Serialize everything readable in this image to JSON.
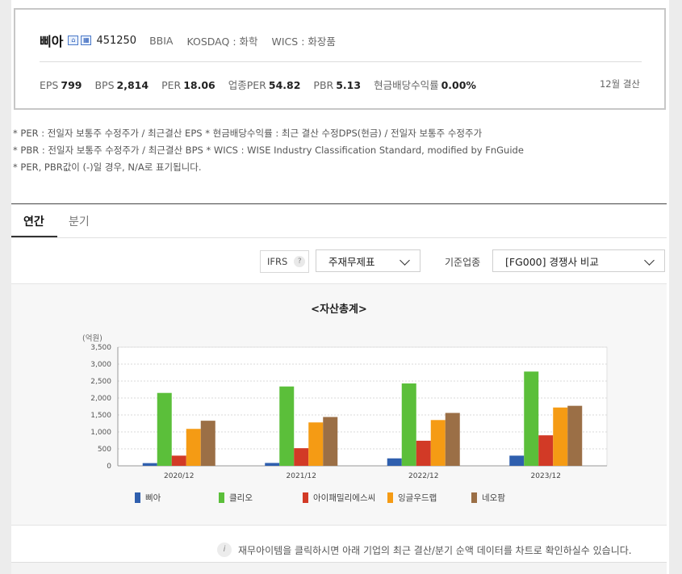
{
  "company": {
    "name": "삐아",
    "code": "451250",
    "ticker": "BBIA",
    "market": "KOSDAQ : 화학",
    "wics": "WICS : 화장품"
  },
  "metrics": [
    {
      "label": "EPS",
      "value": "799"
    },
    {
      "label": "BPS",
      "value": "2,814"
    },
    {
      "label": "PER",
      "value": "18.06"
    },
    {
      "label": "업종PER",
      "value": "54.82"
    },
    {
      "label": "PBR",
      "value": "5.13"
    },
    {
      "label": "현금배당수익률",
      "value": "0.00%"
    }
  ],
  "settlement": "12월 결산",
  "notes": [
    "* PER : 전일자 보통주 수정주가 / 최근결산 EPS * 현금배당수익률 : 최근 결산 수정DPS(현금) / 전일자 보통주 수정주가",
    "* PBR : 전일자 보통주 수정주가 / 최근결산 BPS * WICS : WISE Industry Classification Standard, modified by FnGuide",
    "* PER, PBR값이 (-)일 경우, N/A로 표기됩니다."
  ],
  "tabs": {
    "annual": "연간",
    "quarter": "분기"
  },
  "controls": {
    "ifrs_label": "IFRS",
    "help_glyph": "?",
    "statement_select": "주재무제표",
    "industry_label": "기준업종",
    "industry_select": "[FG000] 경쟁사 비교"
  },
  "chart_data": {
    "type": "bar",
    "title": "<자산총계>",
    "ylabel": "(억원)",
    "ylim": [
      0,
      3500
    ],
    "yticks": [
      "0",
      "500",
      "1,000",
      "1,500",
      "2,000",
      "2,500",
      "3,000",
      "3,500"
    ],
    "categories": [
      "2020/12",
      "2021/12",
      "2022/12",
      "2023/12"
    ],
    "grid": true,
    "legend_position": "bottom",
    "series": [
      {
        "name": "삐아",
        "color": "#2f5fae",
        "values": [
          80,
          85,
          220,
          300
        ]
      },
      {
        "name": "클리오",
        "color": "#5bbf3a",
        "values": [
          2150,
          2340,
          2430,
          2780
        ]
      },
      {
        "name": "아이패밀리에스씨",
        "color": "#d23a26",
        "values": [
          300,
          520,
          740,
          900
        ]
      },
      {
        "name": "잉글우드랩",
        "color": "#f59b14",
        "values": [
          1090,
          1280,
          1350,
          1720
        ]
      },
      {
        "name": "네오팜",
        "color": "#9b6f46",
        "values": [
          1330,
          1440,
          1560,
          1770
        ]
      }
    ]
  },
  "info": {
    "icon_glyph": "i",
    "text": "재무아이템을 클릭하시면 아래 기업의 최근 결산/분기 순액 데이터를 차트로 확인하실수 있습니다."
  }
}
